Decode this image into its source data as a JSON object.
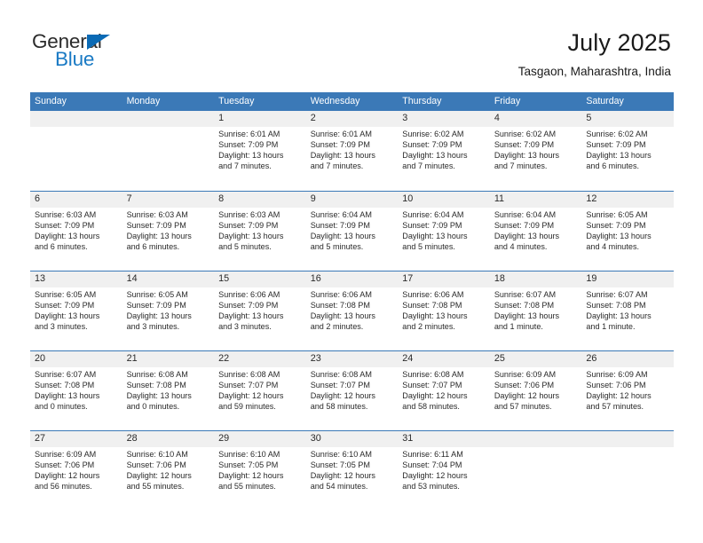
{
  "brand": {
    "name_part1": "General",
    "name_part2": "Blue",
    "logo_icon": "triangle-flag-icon"
  },
  "header": {
    "title": "July 2025",
    "location": "Tasgaon, Maharashtra, India"
  },
  "calendar": {
    "day_names": [
      "Sunday",
      "Monday",
      "Tuesday",
      "Wednesday",
      "Thursday",
      "Friday",
      "Saturday"
    ],
    "header_color": "#3b79b7",
    "daynum_band_color": "#f0f0f0",
    "weeks": [
      [
        {
          "day": "",
          "sunrise": "",
          "sunset": "",
          "daylight_line1": "",
          "daylight_line2": ""
        },
        {
          "day": "",
          "sunrise": "",
          "sunset": "",
          "daylight_line1": "",
          "daylight_line2": ""
        },
        {
          "day": "1",
          "sunrise": "Sunrise: 6:01 AM",
          "sunset": "Sunset: 7:09 PM",
          "daylight_line1": "Daylight: 13 hours",
          "daylight_line2": "and 7 minutes."
        },
        {
          "day": "2",
          "sunrise": "Sunrise: 6:01 AM",
          "sunset": "Sunset: 7:09 PM",
          "daylight_line1": "Daylight: 13 hours",
          "daylight_line2": "and 7 minutes."
        },
        {
          "day": "3",
          "sunrise": "Sunrise: 6:02 AM",
          "sunset": "Sunset: 7:09 PM",
          "daylight_line1": "Daylight: 13 hours",
          "daylight_line2": "and 7 minutes."
        },
        {
          "day": "4",
          "sunrise": "Sunrise: 6:02 AM",
          "sunset": "Sunset: 7:09 PM",
          "daylight_line1": "Daylight: 13 hours",
          "daylight_line2": "and 7 minutes."
        },
        {
          "day": "5",
          "sunrise": "Sunrise: 6:02 AM",
          "sunset": "Sunset: 7:09 PM",
          "daylight_line1": "Daylight: 13 hours",
          "daylight_line2": "and 6 minutes."
        }
      ],
      [
        {
          "day": "6",
          "sunrise": "Sunrise: 6:03 AM",
          "sunset": "Sunset: 7:09 PM",
          "daylight_line1": "Daylight: 13 hours",
          "daylight_line2": "and 6 minutes."
        },
        {
          "day": "7",
          "sunrise": "Sunrise: 6:03 AM",
          "sunset": "Sunset: 7:09 PM",
          "daylight_line1": "Daylight: 13 hours",
          "daylight_line2": "and 6 minutes."
        },
        {
          "day": "8",
          "sunrise": "Sunrise: 6:03 AM",
          "sunset": "Sunset: 7:09 PM",
          "daylight_line1": "Daylight: 13 hours",
          "daylight_line2": "and 5 minutes."
        },
        {
          "day": "9",
          "sunrise": "Sunrise: 6:04 AM",
          "sunset": "Sunset: 7:09 PM",
          "daylight_line1": "Daylight: 13 hours",
          "daylight_line2": "and 5 minutes."
        },
        {
          "day": "10",
          "sunrise": "Sunrise: 6:04 AM",
          "sunset": "Sunset: 7:09 PM",
          "daylight_line1": "Daylight: 13 hours",
          "daylight_line2": "and 5 minutes."
        },
        {
          "day": "11",
          "sunrise": "Sunrise: 6:04 AM",
          "sunset": "Sunset: 7:09 PM",
          "daylight_line1": "Daylight: 13 hours",
          "daylight_line2": "and 4 minutes."
        },
        {
          "day": "12",
          "sunrise": "Sunrise: 6:05 AM",
          "sunset": "Sunset: 7:09 PM",
          "daylight_line1": "Daylight: 13 hours",
          "daylight_line2": "and 4 minutes."
        }
      ],
      [
        {
          "day": "13",
          "sunrise": "Sunrise: 6:05 AM",
          "sunset": "Sunset: 7:09 PM",
          "daylight_line1": "Daylight: 13 hours",
          "daylight_line2": "and 3 minutes."
        },
        {
          "day": "14",
          "sunrise": "Sunrise: 6:05 AM",
          "sunset": "Sunset: 7:09 PM",
          "daylight_line1": "Daylight: 13 hours",
          "daylight_line2": "and 3 minutes."
        },
        {
          "day": "15",
          "sunrise": "Sunrise: 6:06 AM",
          "sunset": "Sunset: 7:09 PM",
          "daylight_line1": "Daylight: 13 hours",
          "daylight_line2": "and 3 minutes."
        },
        {
          "day": "16",
          "sunrise": "Sunrise: 6:06 AM",
          "sunset": "Sunset: 7:08 PM",
          "daylight_line1": "Daylight: 13 hours",
          "daylight_line2": "and 2 minutes."
        },
        {
          "day": "17",
          "sunrise": "Sunrise: 6:06 AM",
          "sunset": "Sunset: 7:08 PM",
          "daylight_line1": "Daylight: 13 hours",
          "daylight_line2": "and 2 minutes."
        },
        {
          "day": "18",
          "sunrise": "Sunrise: 6:07 AM",
          "sunset": "Sunset: 7:08 PM",
          "daylight_line1": "Daylight: 13 hours",
          "daylight_line2": "and 1 minute."
        },
        {
          "day": "19",
          "sunrise": "Sunrise: 6:07 AM",
          "sunset": "Sunset: 7:08 PM",
          "daylight_line1": "Daylight: 13 hours",
          "daylight_line2": "and 1 minute."
        }
      ],
      [
        {
          "day": "20",
          "sunrise": "Sunrise: 6:07 AM",
          "sunset": "Sunset: 7:08 PM",
          "daylight_line1": "Daylight: 13 hours",
          "daylight_line2": "and 0 minutes."
        },
        {
          "day": "21",
          "sunrise": "Sunrise: 6:08 AM",
          "sunset": "Sunset: 7:08 PM",
          "daylight_line1": "Daylight: 13 hours",
          "daylight_line2": "and 0 minutes."
        },
        {
          "day": "22",
          "sunrise": "Sunrise: 6:08 AM",
          "sunset": "Sunset: 7:07 PM",
          "daylight_line1": "Daylight: 12 hours",
          "daylight_line2": "and 59 minutes."
        },
        {
          "day": "23",
          "sunrise": "Sunrise: 6:08 AM",
          "sunset": "Sunset: 7:07 PM",
          "daylight_line1": "Daylight: 12 hours",
          "daylight_line2": "and 58 minutes."
        },
        {
          "day": "24",
          "sunrise": "Sunrise: 6:08 AM",
          "sunset": "Sunset: 7:07 PM",
          "daylight_line1": "Daylight: 12 hours",
          "daylight_line2": "and 58 minutes."
        },
        {
          "day": "25",
          "sunrise": "Sunrise: 6:09 AM",
          "sunset": "Sunset: 7:06 PM",
          "daylight_line1": "Daylight: 12 hours",
          "daylight_line2": "and 57 minutes."
        },
        {
          "day": "26",
          "sunrise": "Sunrise: 6:09 AM",
          "sunset": "Sunset: 7:06 PM",
          "daylight_line1": "Daylight: 12 hours",
          "daylight_line2": "and 57 minutes."
        }
      ],
      [
        {
          "day": "27",
          "sunrise": "Sunrise: 6:09 AM",
          "sunset": "Sunset: 7:06 PM",
          "daylight_line1": "Daylight: 12 hours",
          "daylight_line2": "and 56 minutes."
        },
        {
          "day": "28",
          "sunrise": "Sunrise: 6:10 AM",
          "sunset": "Sunset: 7:06 PM",
          "daylight_line1": "Daylight: 12 hours",
          "daylight_line2": "and 55 minutes."
        },
        {
          "day": "29",
          "sunrise": "Sunrise: 6:10 AM",
          "sunset": "Sunset: 7:05 PM",
          "daylight_line1": "Daylight: 12 hours",
          "daylight_line2": "and 55 minutes."
        },
        {
          "day": "30",
          "sunrise": "Sunrise: 6:10 AM",
          "sunset": "Sunset: 7:05 PM",
          "daylight_line1": "Daylight: 12 hours",
          "daylight_line2": "and 54 minutes."
        },
        {
          "day": "31",
          "sunrise": "Sunrise: 6:11 AM",
          "sunset": "Sunset: 7:04 PM",
          "daylight_line1": "Daylight: 12 hours",
          "daylight_line2": "and 53 minutes."
        },
        {
          "day": "",
          "sunrise": "",
          "sunset": "",
          "daylight_line1": "",
          "daylight_line2": ""
        },
        {
          "day": "",
          "sunrise": "",
          "sunset": "",
          "daylight_line1": "",
          "daylight_line2": ""
        }
      ]
    ]
  }
}
